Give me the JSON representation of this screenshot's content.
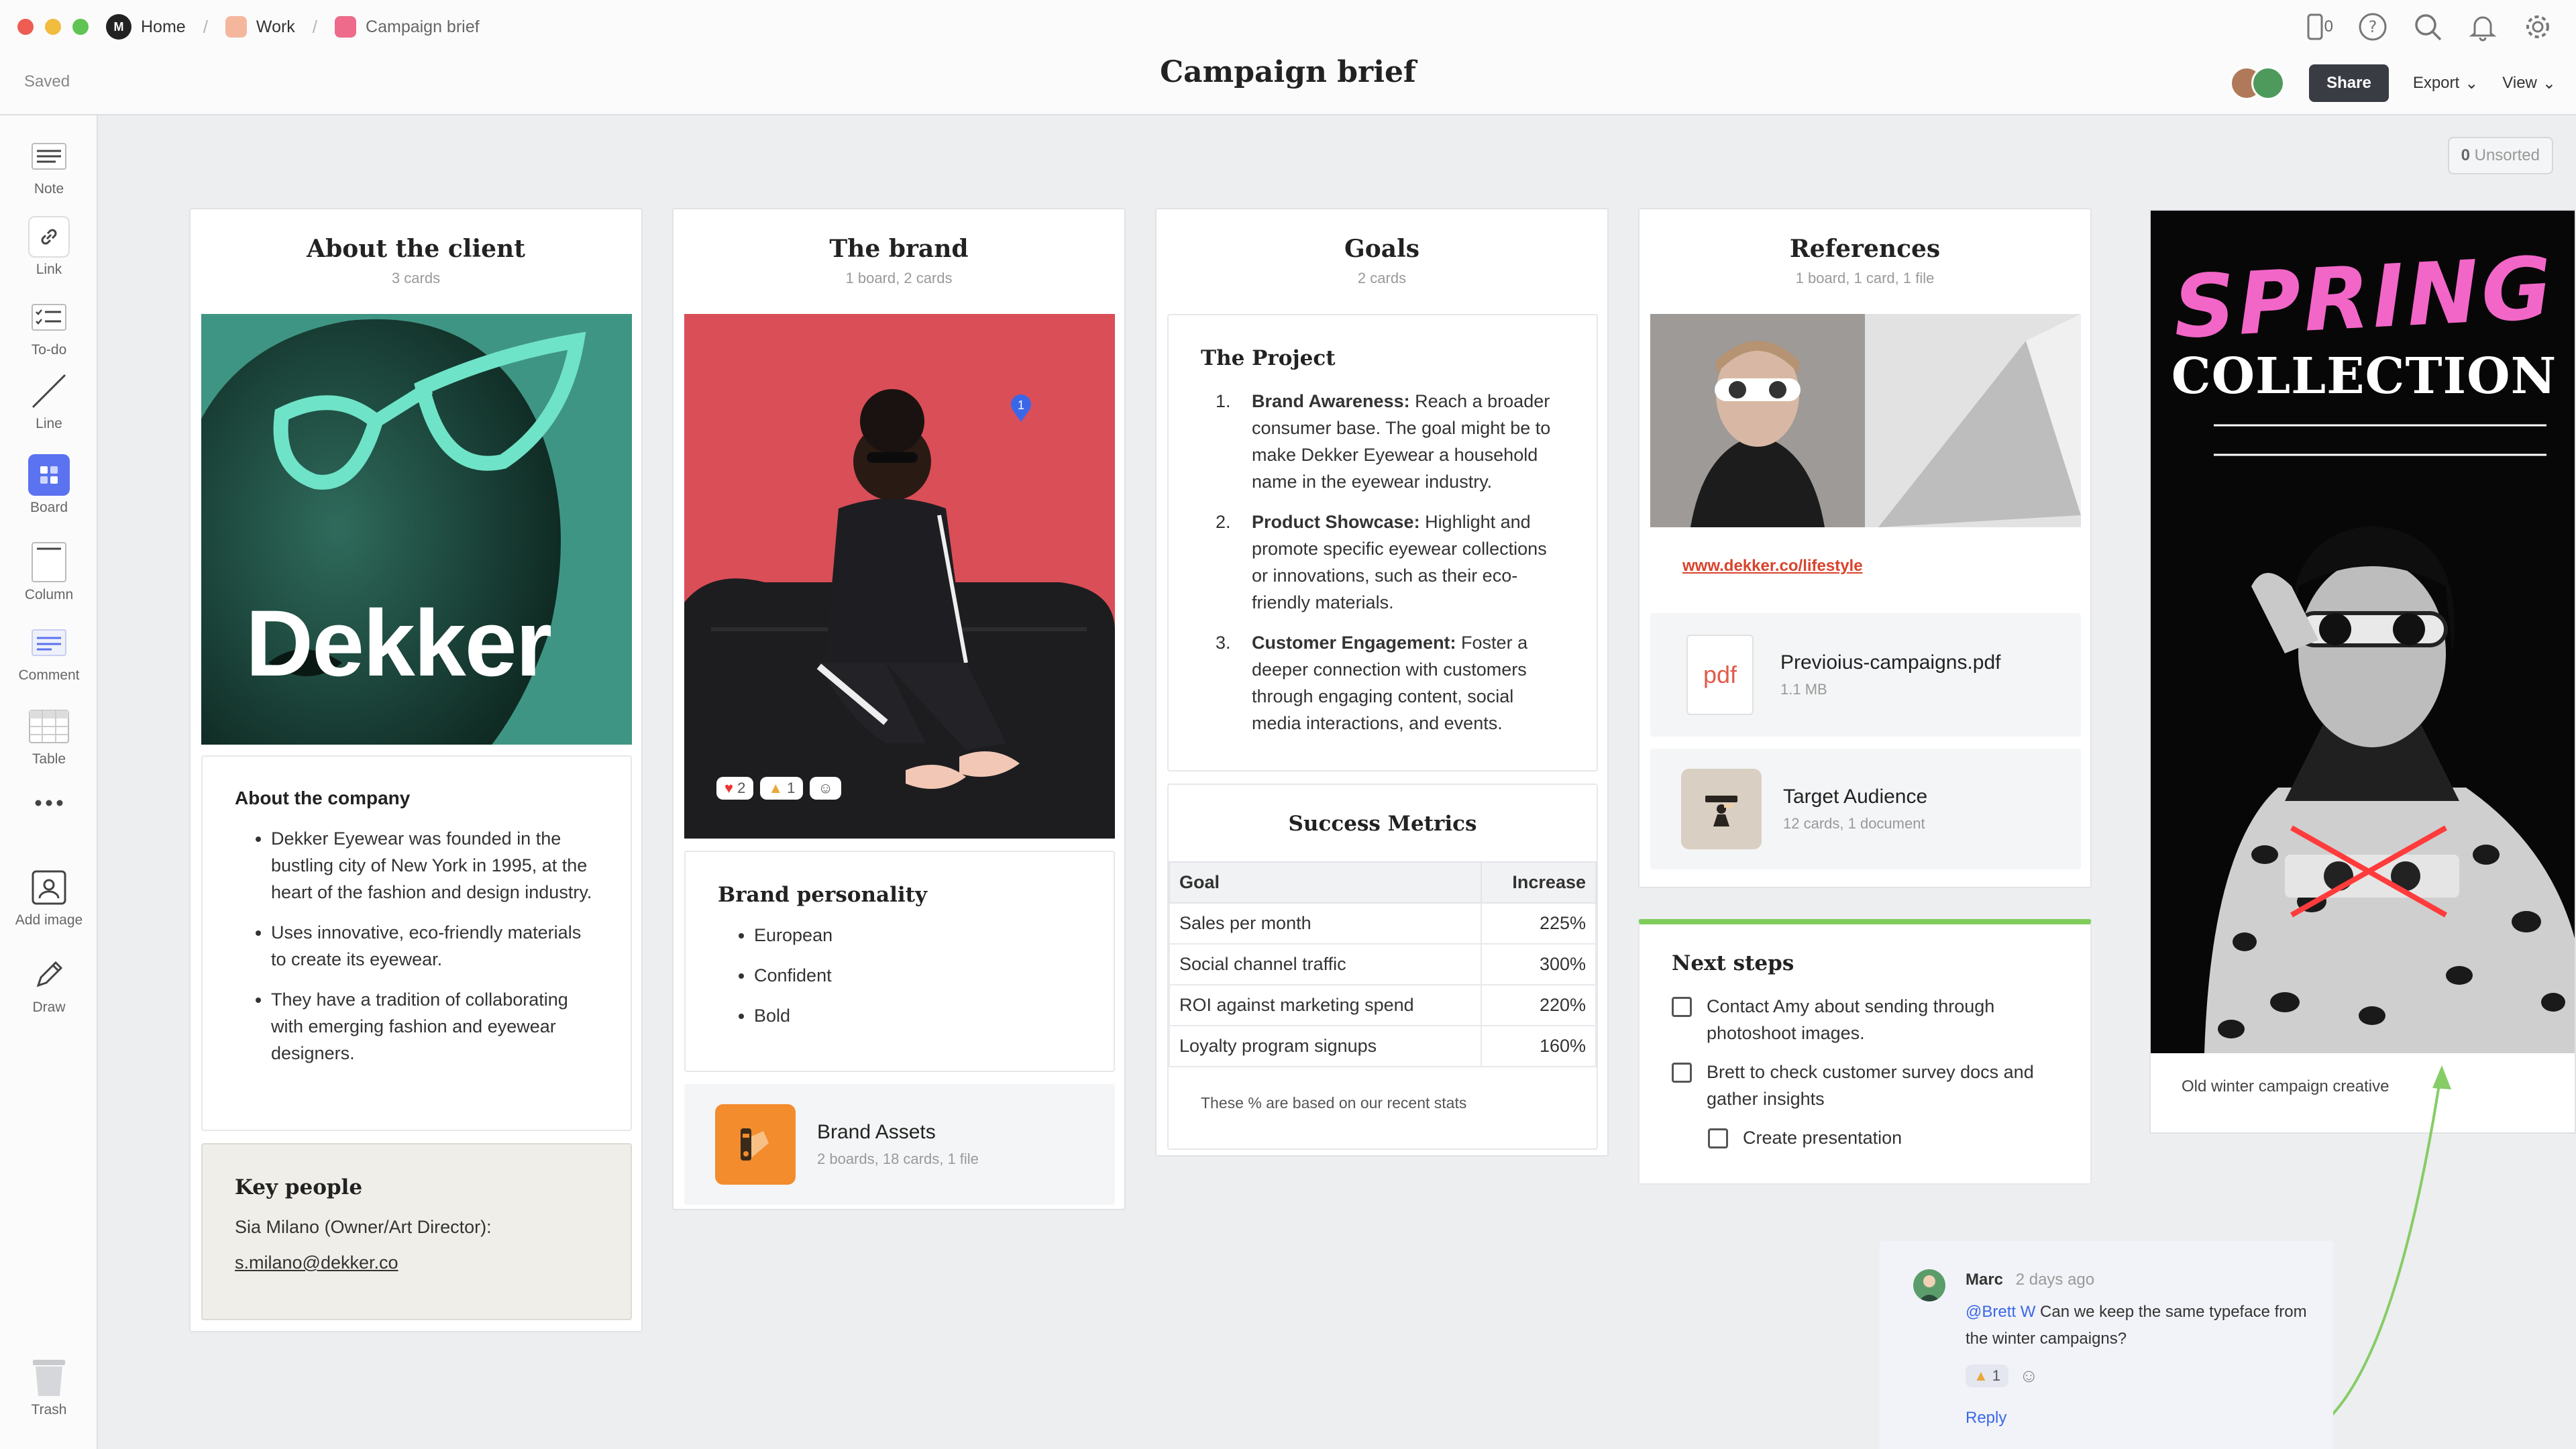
{
  "breadcrumbs": [
    {
      "label": "Home",
      "color": "#222222"
    },
    {
      "label": "Work",
      "color": "#f4b79e"
    },
    {
      "label": "Campaign brief",
      "color": "#ee6b8b"
    }
  ],
  "status": "Saved",
  "title": "Campaign brief",
  "top_icons": {
    "device_count": "0",
    "icons": [
      "device-icon",
      "help-icon",
      "search-icon",
      "bell-icon",
      "gear-icon"
    ]
  },
  "actions": {
    "share": "Share",
    "export": "Export",
    "view": "View"
  },
  "toolbar": [
    {
      "label": "Note",
      "icon": "note-icon"
    },
    {
      "label": "Link",
      "icon": "link-icon"
    },
    {
      "label": "To-do",
      "icon": "todo-icon"
    },
    {
      "label": "Line",
      "icon": "line-icon"
    },
    {
      "label": "Board",
      "icon": "board-icon"
    },
    {
      "label": "Column",
      "icon": "column-icon"
    },
    {
      "label": "Comment",
      "icon": "comment-icon"
    },
    {
      "label": "Table",
      "icon": "table-icon"
    },
    {
      "label": "Add image",
      "icon": "add-image-icon"
    },
    {
      "label": "Draw",
      "icon": "draw-icon"
    },
    {
      "label": "Trash",
      "icon": "trash-icon"
    }
  ],
  "unsorted": {
    "count": "0",
    "label": "Unsorted"
  },
  "columns": {
    "client": {
      "title": "About the client",
      "subtitle": "3 cards",
      "logo_text": "Dekker",
      "about": {
        "heading": "About the company",
        "items": [
          "Dekker Eyewear was founded in the bustling city of New York in 1995, at the heart of the fashion and design industry.",
          "Uses innovative, eco-friendly materials to create its eyewear.",
          "They have a tradition of collaborating with emerging fashion and eyewear designers."
        ]
      },
      "people": {
        "heading": "Key people",
        "line": "Sia Milano (Owner/Art Director):",
        "email": "s.milano@dekker.co"
      }
    },
    "brand": {
      "title": "The brand",
      "subtitle": "1 board, 2 cards",
      "pin": "1",
      "reactions": [
        "2",
        "1"
      ],
      "personality": {
        "heading": "Brand personality",
        "items": [
          "European",
          "Confident",
          "Bold"
        ]
      },
      "assets": {
        "title": "Brand Assets",
        "subtitle": "2 boards, 18 cards, 1 file"
      }
    },
    "goals": {
      "title": "Goals",
      "subtitle": "2 cards",
      "project": {
        "heading": "The Project",
        "items": [
          {
            "bold": "Brand Awareness:",
            "text": " Reach a broader consumer base. The goal might be to make Dekker Eyewear a household name in the eyewear industry."
          },
          {
            "bold": "Product Showcase:",
            "text": " Highlight and promote specific eyewear collections or innovations, such as their eco-friendly materials."
          },
          {
            "bold": "Customer Engagement:",
            "text": " Foster a deeper connection with customers through engaging content, social media interactions, and events."
          }
        ]
      },
      "metrics": {
        "heading": "Success Metrics",
        "columns": [
          "Goal",
          "Increase"
        ],
        "rows": [
          [
            "Sales per month",
            "225%"
          ],
          [
            "Social channel traffic",
            "300%"
          ],
          [
            "ROI against marketing spend",
            "220%"
          ],
          [
            "Loyalty program signups",
            "160%"
          ]
        ],
        "note": "These % are based on our recent stats"
      }
    },
    "references": {
      "title": "References",
      "subtitle": "1 board, 1 card, 1 file",
      "link": "www.dekker.co/lifestyle",
      "file": {
        "icon_text": "pdf",
        "name": "Previoius-campaigns.pdf",
        "size": "1.1 MB"
      },
      "audience": {
        "title": "Target Audience",
        "subtitle": "12 cards, 1 document"
      },
      "next_steps": {
        "heading": "Next steps",
        "items": [
          "Contact Amy about sending through photoshoot images.",
          "Brett to check customer survey docs and gather insights",
          "Create presentation"
        ]
      }
    }
  },
  "poster": {
    "line1": "SPRING",
    "line2": "COLLECTION",
    "caption": "Old winter campaign creative"
  },
  "comment": {
    "author": "Marc",
    "time": "2 days ago",
    "mention": "@Brett W",
    "text": " Can we keep the same typeface from the winter campaigns?",
    "reaction_count": "1",
    "reply": "Reply"
  }
}
